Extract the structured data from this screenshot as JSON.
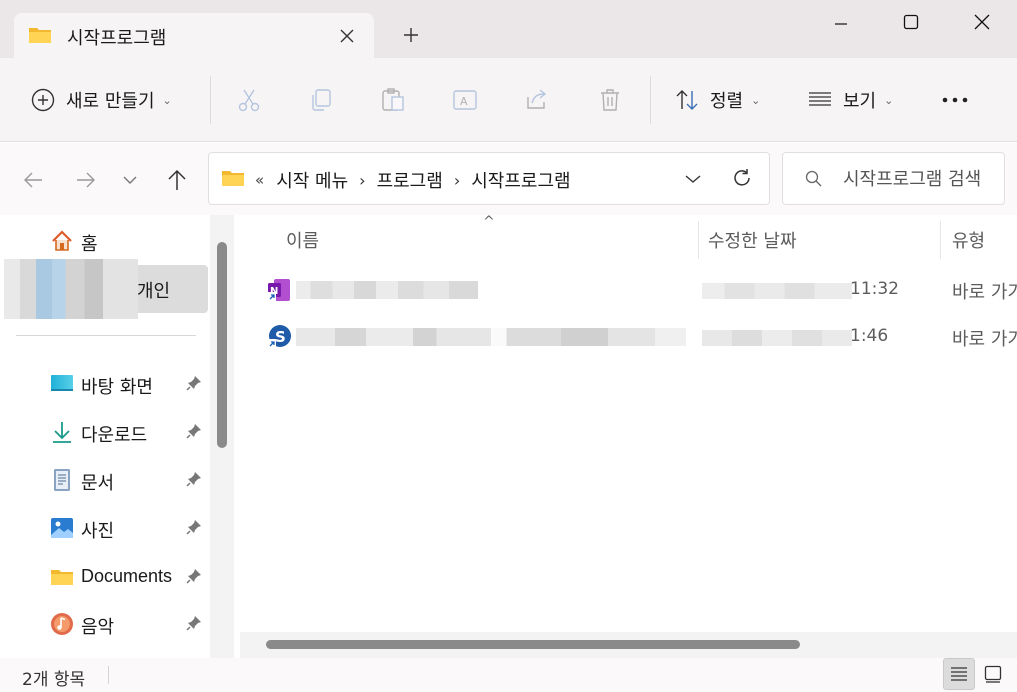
{
  "window": {
    "tab_title": "시작프로그램",
    "colors": {
      "folder": "#f7c948",
      "accent": "#0067c0"
    }
  },
  "commandbar": {
    "new_label": "새로 만들기",
    "sort_label": "정렬",
    "view_label": "보기"
  },
  "address": {
    "overflow": "«",
    "crumbs": [
      "시작 메뉴",
      "프로그램",
      "시작프로그램"
    ],
    "separator": "›"
  },
  "search": {
    "placeholder": "시작프로그램 검색"
  },
  "sidebar": {
    "home": "홈",
    "personal": "개인",
    "items": [
      {
        "label": "바탕 화면",
        "icon": "desktop-icon"
      },
      {
        "label": "다운로드",
        "icon": "download-icon"
      },
      {
        "label": "문서",
        "icon": "document-icon"
      },
      {
        "label": "사진",
        "icon": "pictures-icon"
      },
      {
        "label": "Documents",
        "icon": "folder-icon"
      },
      {
        "label": "음악",
        "icon": "music-icon"
      }
    ]
  },
  "columns": {
    "name": "이름",
    "date": "수정한 날짜",
    "type": "유형"
  },
  "files": [
    {
      "time": "11:32",
      "type": "바로 가기",
      "icon": "onenote-shortcut-icon"
    },
    {
      "time": "1:46",
      "type": "바로 가기",
      "icon": "app-s-shortcut-icon"
    }
  ],
  "status": {
    "count": "2개 항목"
  }
}
